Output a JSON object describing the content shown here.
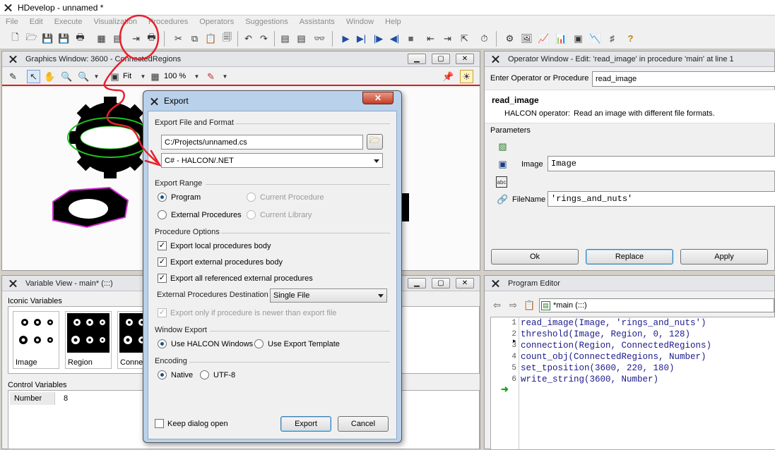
{
  "app": {
    "title": "HDevelop - unnamed *"
  },
  "menu": [
    "File",
    "Edit",
    "Execute",
    "Visualization",
    "Procedures",
    "Operators",
    "Suggestions",
    "Assistants",
    "Window",
    "Help"
  ],
  "graphics": {
    "title": "Graphics Window: 3600 - ConnectedRegions",
    "zoom_fit": "Fit",
    "zoom_percent": "100 %"
  },
  "operator_window": {
    "title": "Operator Window - Edit: 'read_image' in procedure 'main' at line 1",
    "enter_label": "Enter Operator or Procedure",
    "enter_value": "read_image",
    "op_name": "read_image",
    "op_kind": "HALCON operator:",
    "op_desc": "Read an image with different file formats.",
    "params_label": "Parameters",
    "params": [
      {
        "name": "Image",
        "value": "Image"
      },
      {
        "name": "FileName",
        "value": "'rings_and_nuts'"
      }
    ],
    "ok": "Ok",
    "replace": "Replace",
    "apply": "Apply"
  },
  "variable_view": {
    "title": "Variable View - main* (:::)",
    "iconic_label": "Iconic Variables",
    "iconic": [
      "Image",
      "Region",
      "ConnectedRegions"
    ],
    "iconic_visible": [
      "Image",
      "Region",
      "Conne"
    ],
    "control_label": "Control Variables",
    "controls": [
      {
        "name": "Number",
        "value": "8"
      }
    ]
  },
  "program_editor": {
    "title": "Program Editor",
    "procedure": "*main (:::)",
    "lines": [
      {
        "n": "1",
        "code": "read_image(Image, 'rings_and_nuts')"
      },
      {
        "n": "2",
        "code": "threshold(Image, Region, 0, 128)"
      },
      {
        "n": "3",
        "code": "connection(Region, ConnectedRegions)"
      },
      {
        "n": "4",
        "code": "count_obj(ConnectedRegions, Number)"
      },
      {
        "n": "5",
        "code": "set_tposition(3600, 220, 180)"
      },
      {
        "n": "6",
        "code": "write_string(3600, Number)"
      }
    ]
  },
  "export_dialog": {
    "title": "Export",
    "file_format_label": "Export File and Format",
    "file_path": "C:/Projects/unnamed.cs",
    "format": "C# - HALCON/.NET",
    "range_label": "Export Range",
    "range_program": "Program",
    "range_current_procedure": "Current Procedure",
    "range_external_procedures": "External Procedures",
    "range_current_library": "Current Library",
    "options_label": "Procedure Options",
    "opt_local": "Export local procedures body",
    "opt_external": "Export external procedures body",
    "opt_referenced": "Export all referenced external procedures",
    "dest_label": "External Procedures Destination",
    "dest_value": "Single File",
    "opt_newer": "Export only if procedure is newer than export file",
    "window_label": "Window Export",
    "window_halcon": "Use HALCON Windows",
    "window_template": "Use Export Template",
    "encoding_label": "Encoding",
    "enc_native": "Native",
    "enc_utf8": "UTF-8",
    "keep_open": "Keep dialog open",
    "export_btn": "Export",
    "cancel_btn": "Cancel"
  },
  "annotation_color": "#e8202a"
}
